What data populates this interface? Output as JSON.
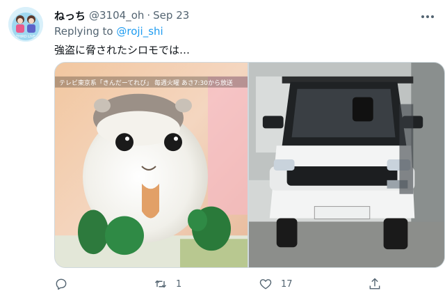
{
  "tweet": {
    "display_name": "ねっち",
    "handle": "@3104_oh",
    "separator": "·",
    "date": "Sep 23",
    "reply_prefix": "Replying to",
    "reply_to": "@roji_shi",
    "text": "強盗に脅されたシロモでは…",
    "avatar_badge_text": "THIRD LIVE",
    "media_caption": "テレビ東京系「きんだーてれび」 毎週火曜 あさ7:30から放送"
  },
  "actions": {
    "reply_count": "",
    "retweet_count": "1",
    "like_count": "17"
  },
  "icons": {
    "more": "more-horizontal-icon",
    "reply": "reply-icon",
    "retweet": "retweet-icon",
    "like": "heart-icon",
    "share": "share-icon"
  },
  "colors": {
    "link": "#1d9bf0",
    "secondary_text": "#536471",
    "primary_text": "#0f1419",
    "border": "#cfd9de"
  }
}
